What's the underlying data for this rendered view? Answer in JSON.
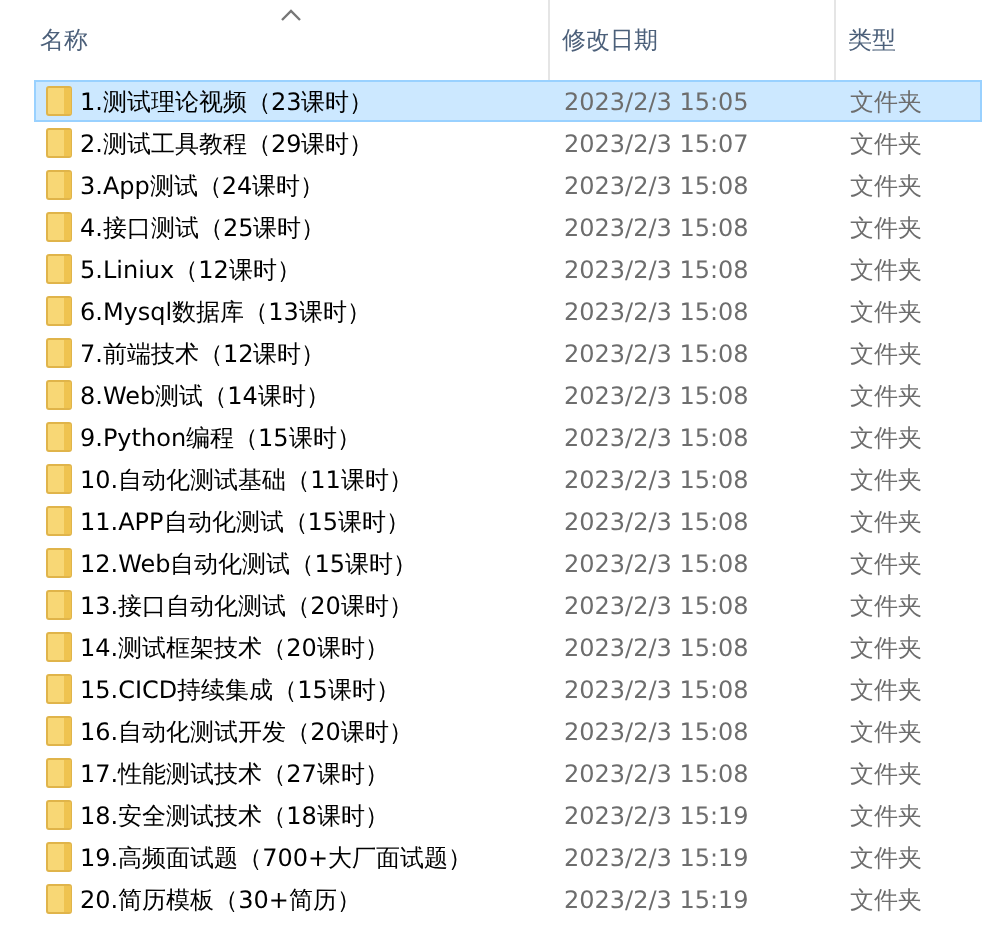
{
  "columns": [
    {
      "label": "名称",
      "sorted": true
    },
    {
      "label": "修改日期",
      "sorted": false
    },
    {
      "label": "类型",
      "sorted": false
    }
  ],
  "rows": [
    {
      "name": "1.测试理论视频（23课时）",
      "date": "2023/2/3 15:05",
      "type": "文件夹",
      "selected": true
    },
    {
      "name": "2.测试工具教程（29课时）",
      "date": "2023/2/3 15:07",
      "type": "文件夹",
      "selected": false
    },
    {
      "name": "3.App测试（24课时）",
      "date": "2023/2/3 15:08",
      "type": "文件夹",
      "selected": false
    },
    {
      "name": "4.接口测试（25课时）",
      "date": "2023/2/3 15:08",
      "type": "文件夹",
      "selected": false
    },
    {
      "name": "5.Liniux（12课时）",
      "date": "2023/2/3 15:08",
      "type": "文件夹",
      "selected": false
    },
    {
      "name": "6.Mysql数据库（13课时）",
      "date": "2023/2/3 15:08",
      "type": "文件夹",
      "selected": false
    },
    {
      "name": "7.前端技术（12课时）",
      "date": "2023/2/3 15:08",
      "type": "文件夹",
      "selected": false
    },
    {
      "name": "8.Web测试（14课时）",
      "date": "2023/2/3 15:08",
      "type": "文件夹",
      "selected": false
    },
    {
      "name": "9.Python编程（15课时）",
      "date": "2023/2/3 15:08",
      "type": "文件夹",
      "selected": false
    },
    {
      "name": "10.自动化测试基础（11课时）",
      "date": "2023/2/3 15:08",
      "type": "文件夹",
      "selected": false
    },
    {
      "name": "11.APP自动化测试（15课时）",
      "date": "2023/2/3 15:08",
      "type": "文件夹",
      "selected": false
    },
    {
      "name": "12.Web自动化测试（15课时）",
      "date": "2023/2/3 15:08",
      "type": "文件夹",
      "selected": false
    },
    {
      "name": "13.接口自动化测试（20课时）",
      "date": "2023/2/3 15:08",
      "type": "文件夹",
      "selected": false
    },
    {
      "name": "14.测试框架技术（20课时）",
      "date": "2023/2/3 15:08",
      "type": "文件夹",
      "selected": false
    },
    {
      "name": "15.CICD持续集成（15课时）",
      "date": "2023/2/3 15:08",
      "type": "文件夹",
      "selected": false
    },
    {
      "name": "16.自动化测试开发（20课时）",
      "date": "2023/2/3 15:08",
      "type": "文件夹",
      "selected": false
    },
    {
      "name": "17.性能测试技术（27课时）",
      "date": "2023/2/3 15:08",
      "type": "文件夹",
      "selected": false
    },
    {
      "name": "18.安全测试技术（18课时）",
      "date": "2023/2/3 15:19",
      "type": "文件夹",
      "selected": false
    },
    {
      "name": "19.高频面试题（700+大厂面试题）",
      "date": "2023/2/3 15:19",
      "type": "文件夹",
      "selected": false
    },
    {
      "name": "20.简历模板（30+简历）",
      "date": "2023/2/3 15:19",
      "type": "文件夹",
      "selected": false
    }
  ]
}
